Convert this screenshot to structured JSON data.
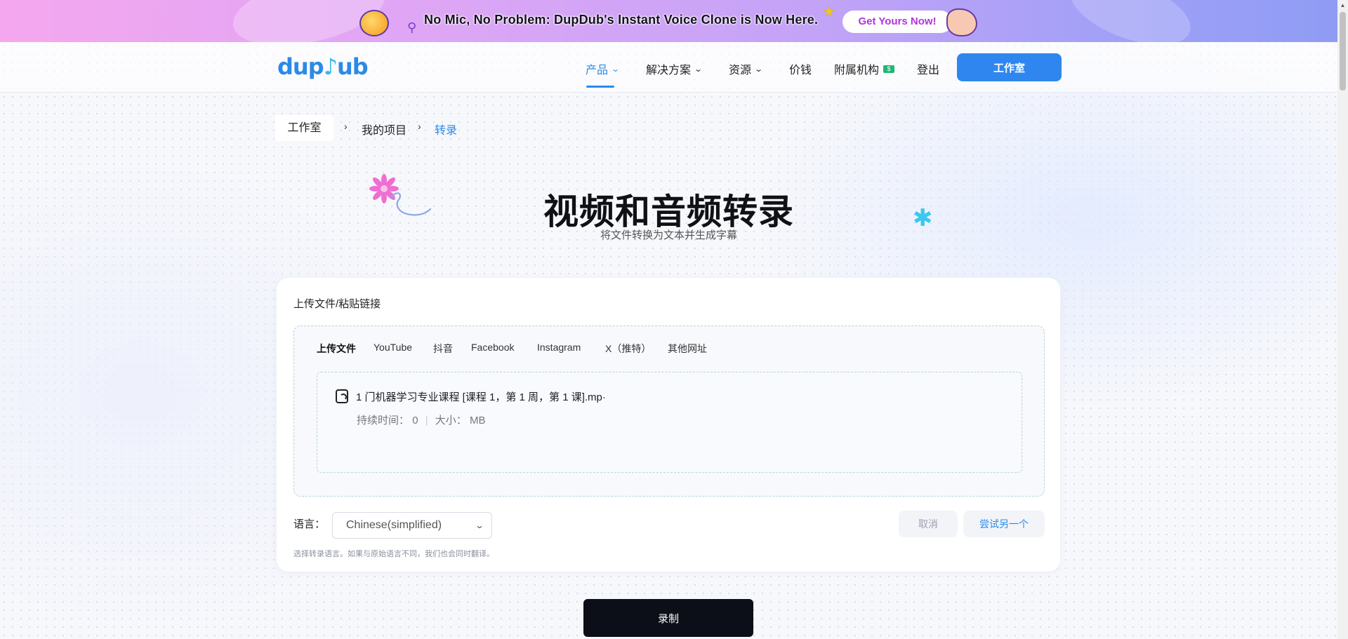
{
  "banner": {
    "promo_text": "No Mic, No Problem: DupDub's Instant Voice Clone is Now Here.",
    "cta_label": "Get Yours Now!"
  },
  "header": {
    "logo_text": "dupdub",
    "nav": [
      {
        "label": "产品",
        "has_dropdown": true,
        "active": true
      },
      {
        "label": "解决方案",
        "has_dropdown": true
      },
      {
        "label": "资源",
        "has_dropdown": true
      },
      {
        "label": "价钱"
      },
      {
        "label": "附属机构"
      },
      {
        "label": "登出"
      }
    ],
    "studio_button": "工作室"
  },
  "breadcrumb": {
    "home": "工作室",
    "items": [
      "我的项目",
      "转录"
    ],
    "separator": "›"
  },
  "hero": {
    "title": "视频和音频转录",
    "subtitle": "将文件转换为文本并生成字幕"
  },
  "card": {
    "section_label": "上传文件/粘贴链接",
    "tabs": [
      "上传文件",
      "YouTube",
      "抖音",
      "Facebook",
      "Instagram",
      "X（推特）",
      "其他网址"
    ],
    "file": {
      "name": "1 门机器学习专业课程 [课程 1，第 1 周，第 1 课].mp·",
      "duration_label": "持续时间：",
      "duration_value": "0",
      "size_label": "大小：",
      "size_value": "MB"
    },
    "language_label": "语言：",
    "language_value": "Chinese(simplified)",
    "cancel_label": "取消",
    "retry_label": "尝试另一个",
    "hint": "选择转录语言。如果与原始语言不同，我们也会同时翻译。"
  },
  "record_button": "录制",
  "colors": {
    "accent": "#2b8ae8",
    "primary_dark": "#0c0f17"
  }
}
